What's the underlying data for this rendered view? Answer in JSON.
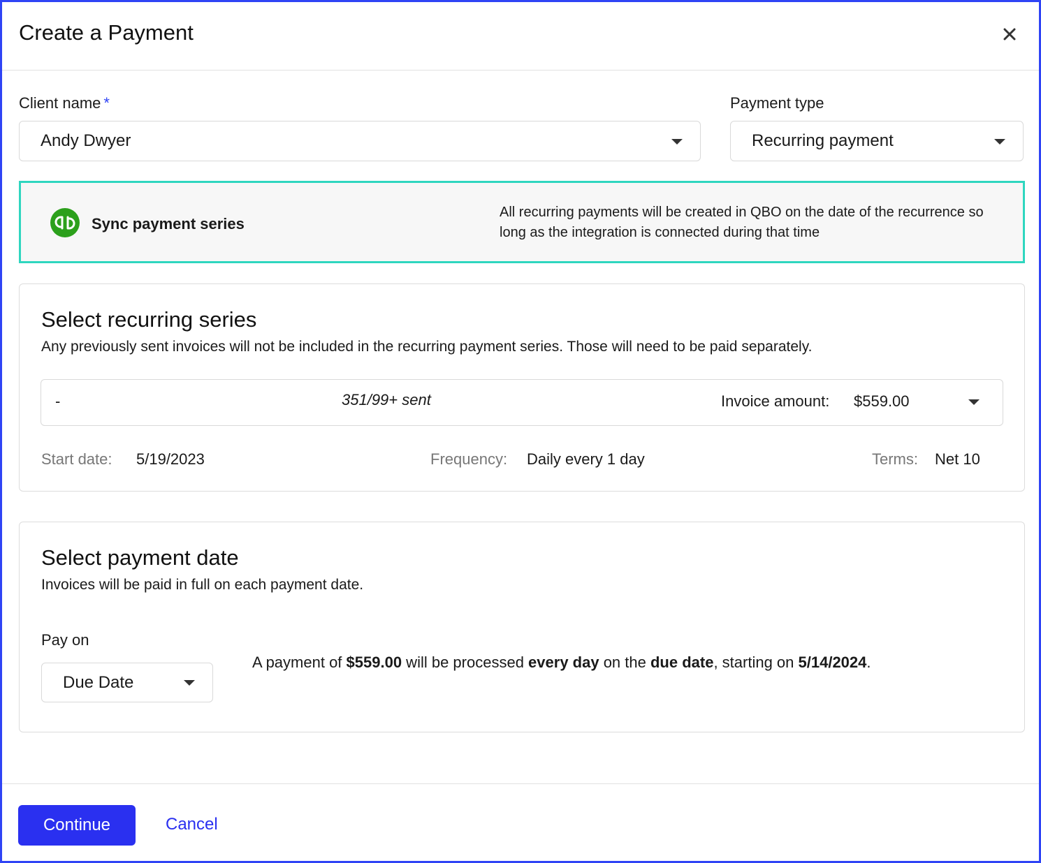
{
  "dialog": {
    "title": "Create a Payment",
    "close_icon": "close-icon"
  },
  "client": {
    "label": "Client name",
    "required_mark": "*",
    "value": "Andy Dwyer"
  },
  "payment_type": {
    "label": "Payment type",
    "value": "Recurring payment"
  },
  "sync": {
    "icon": "quickbooks-logo-icon",
    "title": "Sync payment series",
    "description": "All recurring payments will be created in QBO on the date of the recurrence so long as the integration is connected during that time",
    "border_color": "#2fd6bf",
    "logo_color": "#2ca01c"
  },
  "recurring_series": {
    "title": "Select recurring series",
    "description": "Any previously sent invoices will not be included in the recurring payment series. Those will need to be paid separately.",
    "selected": {
      "name": "-",
      "sent": "351/99+ sent",
      "amount_label": "Invoice amount:",
      "amount_value": "$559.00"
    },
    "start_date_label": "Start date:",
    "start_date_value": "5/19/2023",
    "frequency_label": "Frequency:",
    "frequency_value": "Daily every 1 day",
    "terms_label": "Terms:",
    "terms_value": "Net 10"
  },
  "payment_date": {
    "title": "Select payment date",
    "description": "Invoices will be paid in full on each payment date.",
    "pay_on_label": "Pay on",
    "pay_on_value": "Due Date",
    "summary": {
      "p1": "A payment of ",
      "amount": "$559.00",
      "p2": " will be processed ",
      "frequency": "every day",
      "p3": " on the ",
      "date_ref": "due date",
      "p4": ", starting on ",
      "start": "5/14/2024",
      "p5": "."
    }
  },
  "footer": {
    "continue_label": "Continue",
    "cancel_label": "Cancel",
    "accent_color": "#2a30f0"
  }
}
